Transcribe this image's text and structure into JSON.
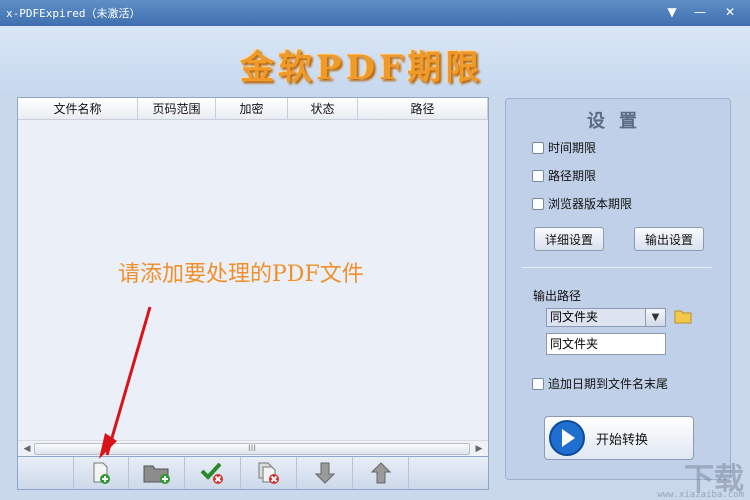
{
  "window": {
    "title": "x-PDFExpired（未激活）",
    "controls": {
      "dropdown": "▼",
      "minimize": "—",
      "close": "✕"
    }
  },
  "banner": {
    "logo_text": "金软PDF期限"
  },
  "file_list": {
    "columns": [
      "文件名称",
      "页码范围",
      "加密",
      "状态",
      "路径"
    ],
    "hint": "请添加要处理的PDF文件",
    "scroll": {
      "left": "◀",
      "right": "▶",
      "grip": "III"
    }
  },
  "toolbar": {
    "buttons": [
      "add-file",
      "add-folder",
      "clear-checked",
      "remove",
      "move-down",
      "move-up"
    ]
  },
  "settings": {
    "title": "设置",
    "time_limit": "时间期限",
    "path_limit": "路径期限",
    "browser_version_limit": "浏览器版本期限",
    "detail_button": "详细设置",
    "output_button": "输出设置",
    "output_path_label": "输出路径",
    "output_select": "同文件夹",
    "output_field": "同文件夹",
    "append_date": "追加日期到文件名末尾",
    "start_button": "开始转换"
  },
  "watermark": {
    "text": "下载",
    "url": "www.xiazaiba.com"
  },
  "colors": {
    "accent": "#f0902a",
    "titlebar": "#3f6fb0",
    "panel": "#bfd0e8"
  }
}
